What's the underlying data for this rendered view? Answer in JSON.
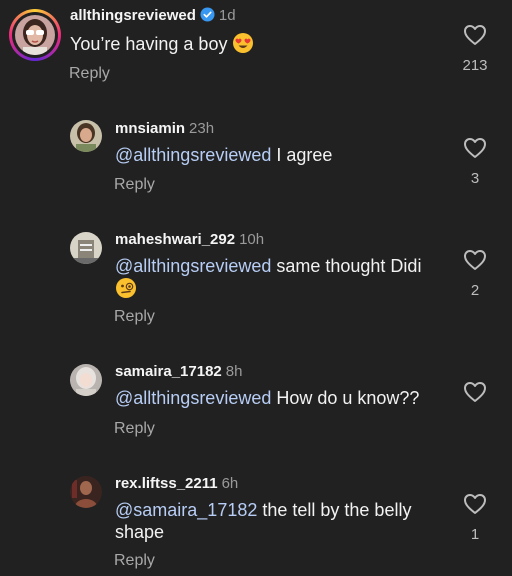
{
  "comments": [
    {
      "username": "allthingsreviewed",
      "verified": true,
      "time": "1d",
      "text": "You’re having a boy",
      "emoji": "heart-eyes-emoji",
      "reply_label": "Reply",
      "likes": "213"
    },
    {
      "username": "mnsiamin",
      "time": "23h",
      "mention": "@allthingsreviewed",
      "text": " I agree",
      "reply_label": "Reply",
      "likes": "3"
    },
    {
      "username": "maheshwari_292",
      "time": "10h",
      "mention": "@allthingsreviewed",
      "text": " same thought Didi",
      "emoji": "face-with-monocle-emoji",
      "reply_label": "Reply",
      "likes": "2"
    },
    {
      "username": "samaira_17182",
      "time": "8h",
      "mention": "@allthingsreviewed",
      "text": " How do u know??",
      "reply_label": "Reply",
      "likes": ""
    },
    {
      "username": "rex.liftss_2211",
      "time": "6h",
      "mention": "@samaira_17182",
      "text": " the tell by the belly shape",
      "reply_label": "Reply",
      "likes": "1"
    }
  ],
  "colors": {
    "background": "#212121",
    "mention": "#b7cdf5",
    "verified": "#3897f0",
    "muted": "#a8a8a8"
  },
  "icons": [
    "heart-outline-icon",
    "verified-badge-icon"
  ]
}
